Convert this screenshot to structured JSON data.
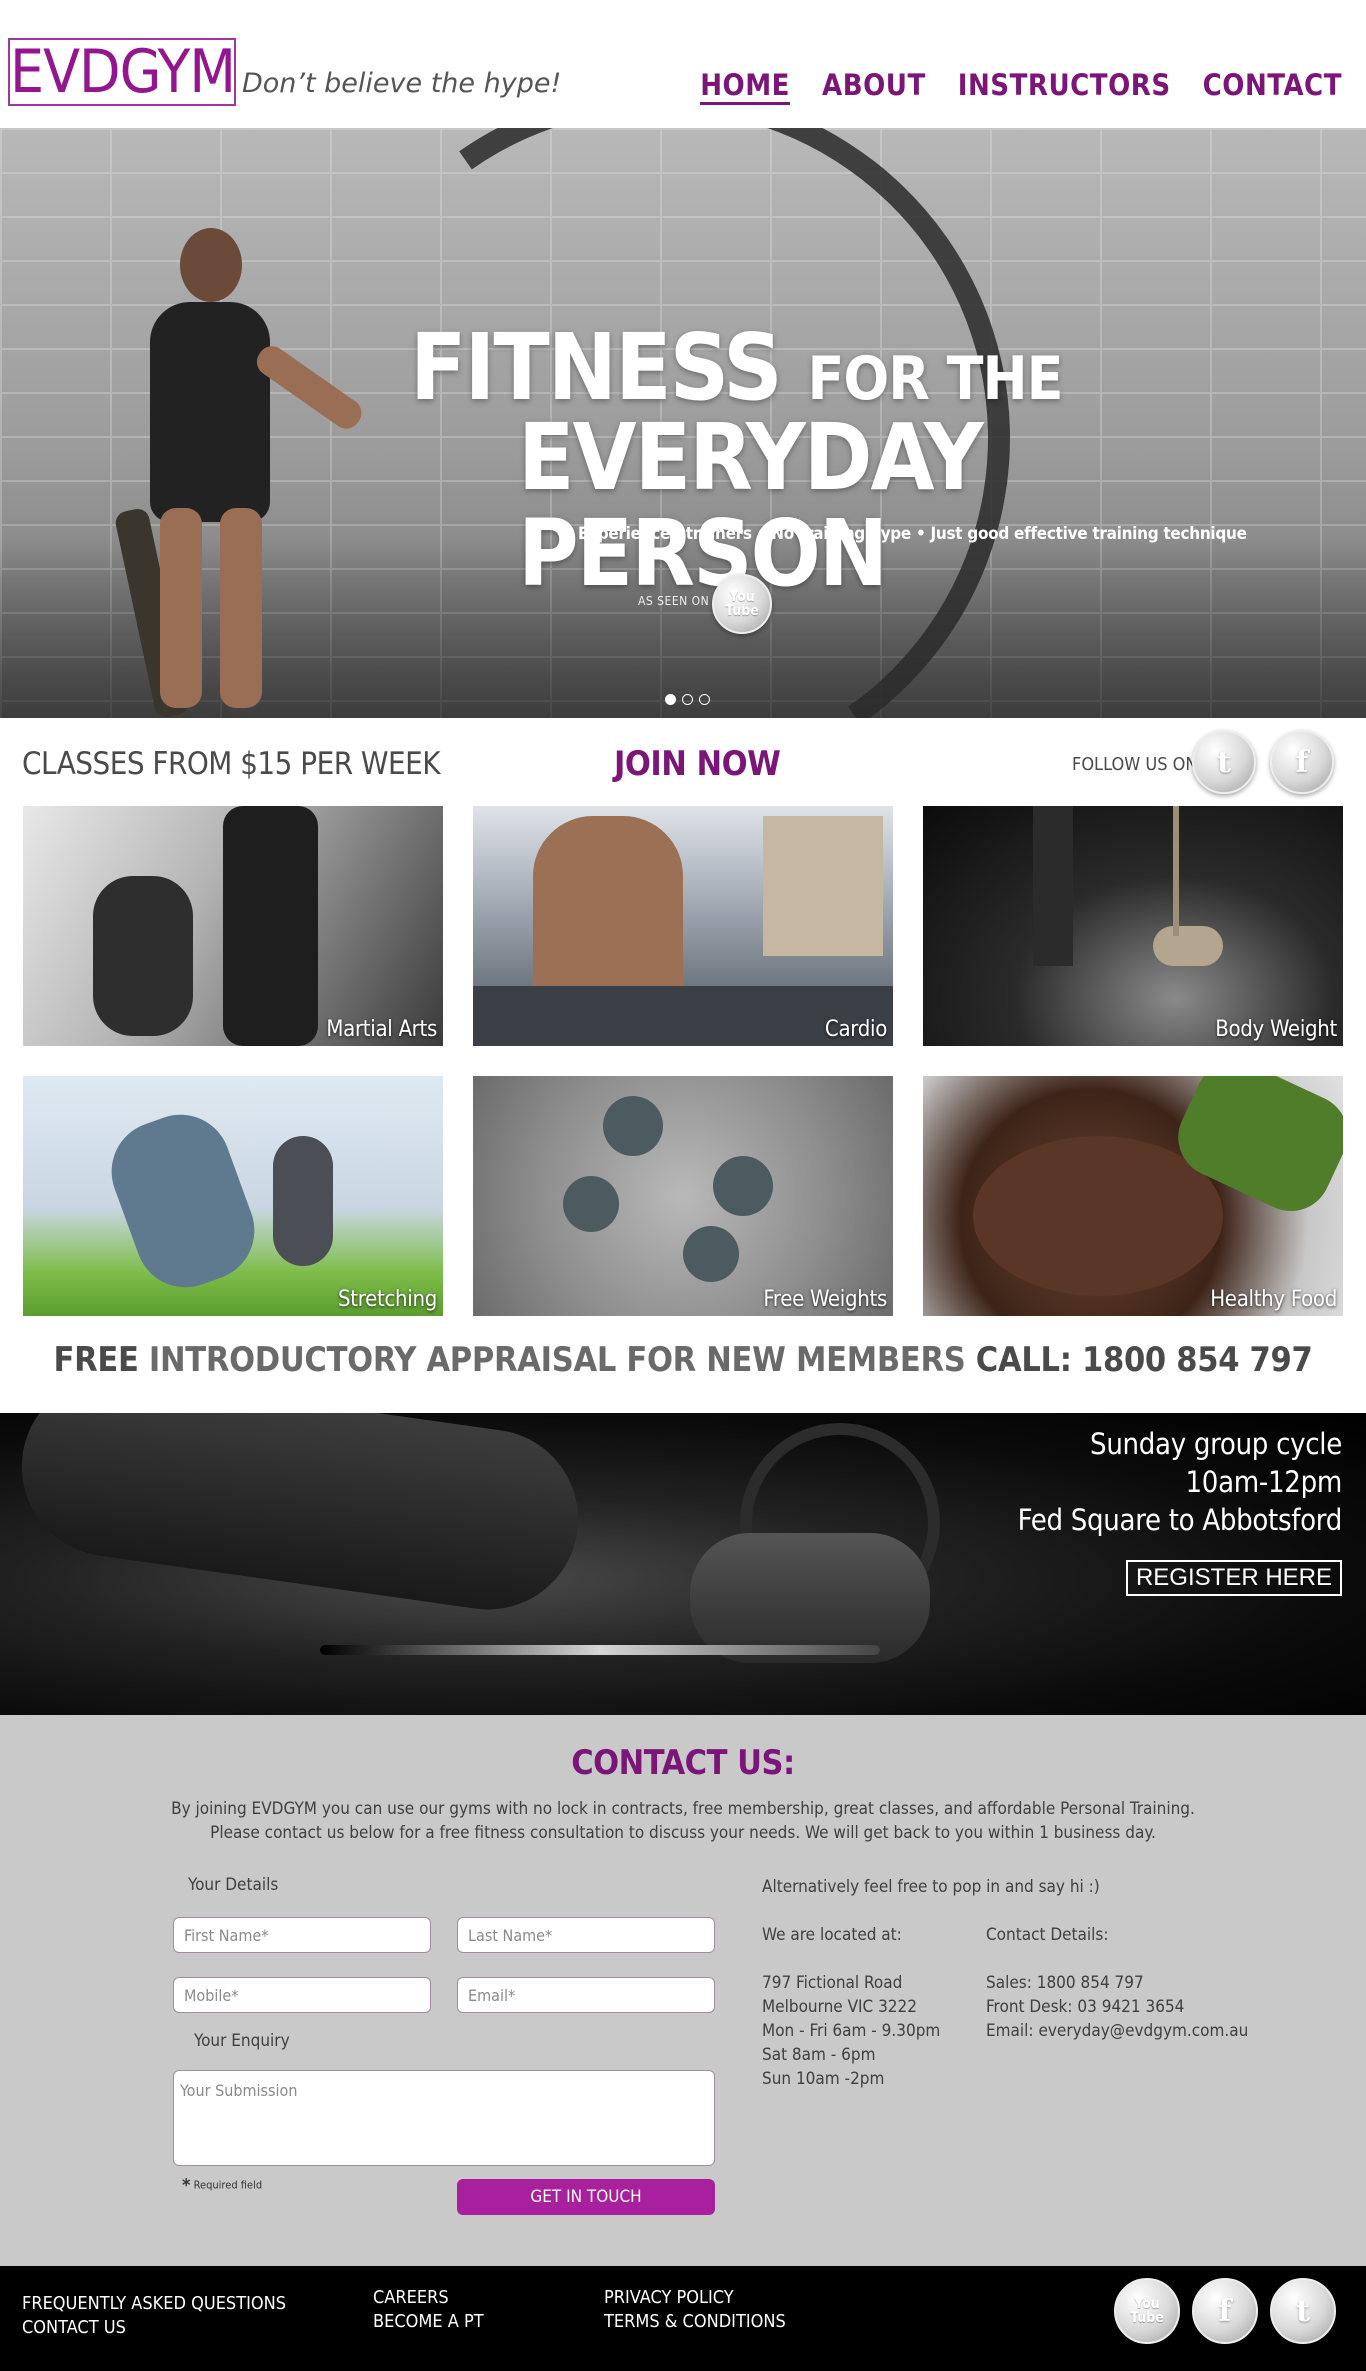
{
  "header": {
    "logo": "EVDGYM",
    "tagline": "Don’t believe the hype!",
    "nav": [
      {
        "label": "HOME",
        "active": true
      },
      {
        "label": "ABOUT",
        "active": false
      },
      {
        "label": "INSTRUCTORS",
        "active": false
      },
      {
        "label": "CONTACT",
        "active": false
      }
    ]
  },
  "hero": {
    "headline_big": "FITNESS",
    "headline_small": "FOR THE",
    "headline_line2": "EVERYDAY PERSON",
    "subheadline": "Experienced trainers • No training hype • Just good effective training technique",
    "as_seen_on": "AS SEEN ON",
    "youtube_badge": {
      "line1": "You",
      "line2": "Tube"
    },
    "slides": 3,
    "active_slide": 1
  },
  "strip": {
    "classes_from": "CLASSES FROM $15 PER WEEK",
    "join_now": "JOIN NOW",
    "follow_us": "FOLLOW US ON",
    "twitter_glyph": "t",
    "facebook_glyph": "f"
  },
  "classes": [
    {
      "caption": "Martial Arts"
    },
    {
      "caption": "Cardio"
    },
    {
      "caption": "Body Weight"
    },
    {
      "caption": "Stretching"
    },
    {
      "caption": "Free Weights"
    },
    {
      "caption": "Healthy Food"
    }
  ],
  "appraisal": {
    "free": "FREE",
    "middle": "INTRODUCTORY APPRAISAL FOR NEW MEMBERS",
    "call": "CALL: 1800 854 797"
  },
  "cycle": {
    "line1": "Sunday group cycle",
    "line2": "10am-12pm",
    "line3": "Fed Square to Abbotsford",
    "register": "REGISTER HERE"
  },
  "contact": {
    "title": "CONTACT US:",
    "intro1": "By joining EVDGYM you can use our gyms with no lock in contracts, free membership, great classes, and affordable Personal Training.",
    "intro2": "Please contact us below for a free fitness consultation to discuss your needs.  We will get back to you within 1 business day.",
    "your_details": "Your Details",
    "first_name": "First Name*",
    "last_name": "Last Name*",
    "mobile": "Mobile*",
    "email": "Email*",
    "your_enquiry": "Your Enquiry",
    "submission": "Your Submission",
    "required": "Required field",
    "required_star": "*",
    "submit": "GET IN TOUCH",
    "alt_text": "Alternatively feel free to pop in and say hi :)",
    "located_label": "We are located at:",
    "address": "797 Fictional Road\nMelbourne VIC 3222\nMon - Fri 6am - 9.30pm\nSat 8am - 6pm\nSun 10am -2pm",
    "details_label": "Contact Details:",
    "details": "Sales: 1800 854 797\nFront Desk: 03 9421 3654\nEmail: everyday@evdgym.com.au"
  },
  "footer": {
    "col1": [
      "FREQUENTLY ASKED QUESTIONS",
      "CONTACT US"
    ],
    "col2": [
      "CAREERS",
      "BECOME A PT"
    ],
    "col3": [
      "PRIVACY POLICY",
      "TERMS & CONDITIONS"
    ],
    "youtube": {
      "line1": "You",
      "line2": "Tube"
    },
    "facebook_glyph": "f",
    "twitter_glyph": "t"
  },
  "colors": {
    "brand_purple": "#7b1678",
    "button_purple": "#a8209d",
    "contact_bg": "#c9c9c9",
    "footer_bg": "#000000"
  }
}
